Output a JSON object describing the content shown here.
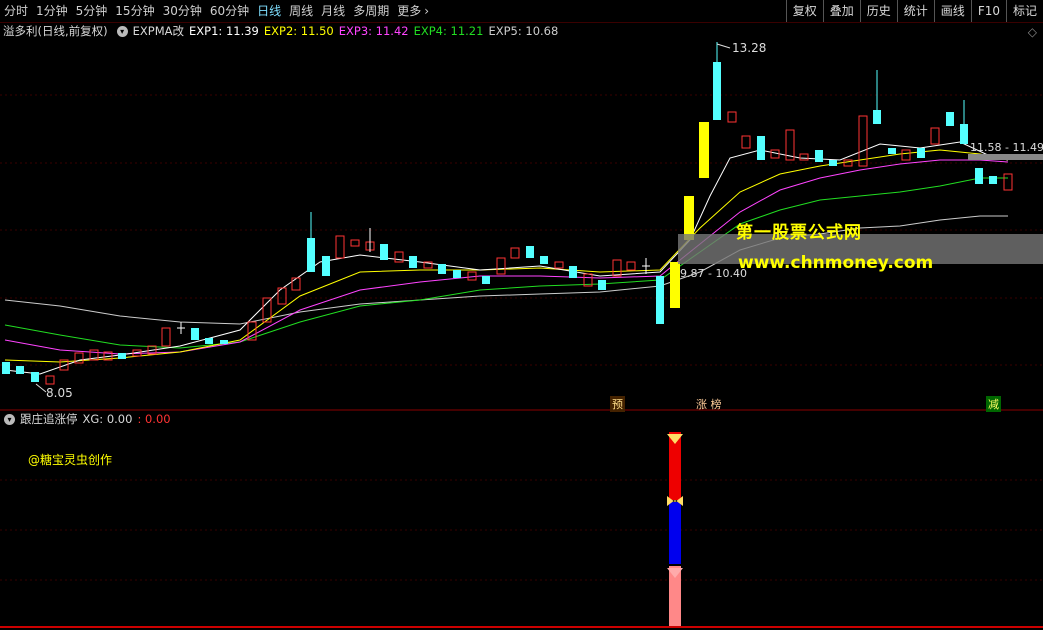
{
  "toolbar": {
    "periods": [
      "分时",
      "1分钟",
      "5分钟",
      "15分钟",
      "30分钟",
      "60分钟",
      "日线",
      "周线",
      "月线",
      "多周期",
      "更多"
    ],
    "active_period": "日线",
    "tools": [
      "复权",
      "叠加",
      "历史",
      "统计",
      "画线",
      "F10",
      "标记"
    ]
  },
  "main_panel": {
    "stock_title": "溢多利(日线,前复权)",
    "indicator_name": "EXPMA改",
    "exp1_label": "EXP1: 11.39",
    "exp2_label": "EXP2: 11.50",
    "exp3_label": "EXP3: 11.42",
    "exp4_label": "EXP4: 11.21",
    "exp5_label": "EXP5: 10.68",
    "colors": {
      "exp1": "#ffffff",
      "exp2": "#ffff00",
      "exp3": "#ff44ff",
      "exp4": "#22dd22",
      "exp5": "#cccccc",
      "up": "#ff3333",
      "down": "#54ffff"
    },
    "high_label": "13.28",
    "low_label": "8.05",
    "range_label_1": "9.87 - 10.40",
    "range_label_2": "11.58 - 11.49",
    "tags": {
      "pre": "预",
      "zhangbang": "涨 榜",
      "jian": "减"
    }
  },
  "sub_panel": {
    "indicator_name": "跟庄追涨停",
    "xg_label": "XG: 0.00",
    "xg_value": "0.00",
    "author": "@糖宝灵虫创作"
  },
  "watermark": {
    "line1": "第一股票公式网",
    "line2": "www.chnmoney.com"
  }
}
